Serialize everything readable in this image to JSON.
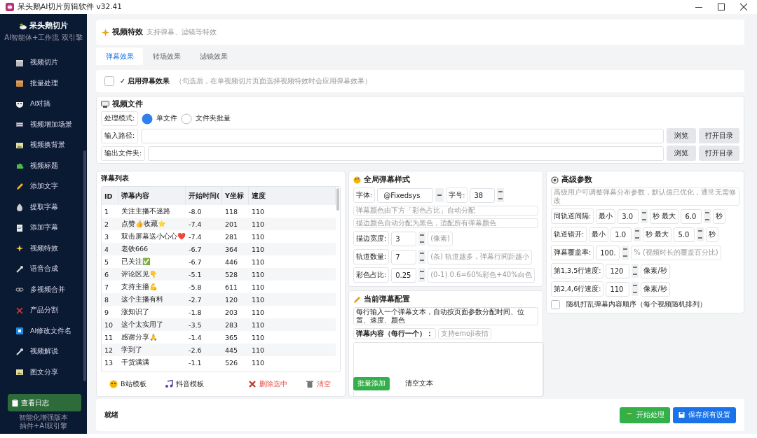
{
  "window": {
    "title": "呆头鹅AI切片剪辑软件 v32.41"
  },
  "sidebar": {
    "brand": "呆头鹅切片",
    "tagline": "AI智能体+工作流 双引擎",
    "items": [
      {
        "label": "视频切片",
        "selected": false
      },
      {
        "label": "批量处理",
        "selected": false
      },
      {
        "label": "AI对搞",
        "selected": false
      },
      {
        "label": "视频增加场景",
        "selected": false
      },
      {
        "label": "视频换背景",
        "selected": false
      },
      {
        "label": "视频标题",
        "selected": false
      },
      {
        "label": "添加文字",
        "selected": false
      },
      {
        "label": "提取字幕",
        "selected": false
      },
      {
        "label": "添加字幕",
        "selected": false
      },
      {
        "label": "视频特效",
        "selected": false
      },
      {
        "label": "语音合成",
        "selected": false
      },
      {
        "label": "多视频合并",
        "selected": false
      },
      {
        "label": "产品分割",
        "selected": false
      },
      {
        "label": "AI修改文件名",
        "selected": false
      },
      {
        "label": "视频解说",
        "selected": false
      },
      {
        "label": "图文分享",
        "selected": false
      }
    ],
    "log_button": "查看日志",
    "footer": [
      "智能化增强版本",
      "插件+AI双引擎"
    ]
  },
  "header": {
    "title": "视频特效",
    "subtitle": "支持弹幕、滤镜等特效"
  },
  "tabs": [
    {
      "label": "弹幕效果",
      "selected": true
    },
    {
      "label": "转场效果",
      "selected": false
    },
    {
      "label": "滤镜效果",
      "selected": false
    }
  ],
  "enable": {
    "label": "✓ 启用弹幕效果",
    "hint": "（勾选后，在单视频切片页面选择视频特效时会应用弹幕效果）",
    "checked": false
  },
  "video_file": {
    "title": "视频文件",
    "mode_label": "处理模式:",
    "modes": [
      {
        "label": "单文件",
        "selected": true
      },
      {
        "label": "文件夹批量",
        "selected": false
      }
    ],
    "paths": [
      {
        "label": "输入路径:",
        "buttons": [
          "浏览",
          "打开目录"
        ]
      },
      {
        "label": "输出文件夹:",
        "buttons": [
          "浏览",
          "打开目录"
        ]
      }
    ]
  },
  "danmaku_list": {
    "title": "弹幕列表",
    "columns": [
      "ID",
      "弹幕内容",
      "开始时间(",
      "Y坐标",
      "速度"
    ],
    "rows": [
      [
        "1",
        "关注主播不迷路",
        "-8.0",
        "118",
        "110"
      ],
      [
        "2",
        "点赞👍收藏⭐",
        "-7.4",
        "201",
        "110"
      ],
      [
        "3",
        "双击屏幕送小心心❤️",
        "-7.4",
        "281",
        "110"
      ],
      [
        "4",
        "老铁666",
        "-6.7",
        "364",
        "110"
      ],
      [
        "5",
        "已关注✅",
        "-6.7",
        "446",
        "110"
      ],
      [
        "6",
        "评论区见👇",
        "-5.1",
        "528",
        "110"
      ],
      [
        "7",
        "支持主播💪",
        "-5.8",
        "611",
        "110"
      ],
      [
        "8",
        "这个主播有料",
        "-2.7",
        "120",
        "110"
      ],
      [
        "9",
        "涨知识了",
        "-1.8",
        "203",
        "110"
      ],
      [
        "10",
        "这个太实用了",
        "-3.5",
        "283",
        "110"
      ],
      [
        "11",
        "感谢分享🙏",
        "-1.4",
        "365",
        "110"
      ],
      [
        "12",
        "学到了",
        "-2.6",
        "445",
        "110"
      ],
      [
        "13",
        "干货满满",
        "-1.1",
        "526",
        "110"
      ]
    ],
    "actions": [
      {
        "label": "B站模板",
        "kind": "bili"
      },
      {
        "label": "抖音模板",
        "kind": "douyin"
      },
      {
        "label": "删除选中",
        "kind": "delete"
      },
      {
        "label": "清空",
        "kind": "clear"
      }
    ]
  },
  "global_style": {
    "title": "全局弹幕样式",
    "font_label": "字体:",
    "font_value": "@Fixedsys",
    "size_label": "字号:",
    "size_value": "38",
    "notes": [
      "弹幕颜色由下方「彩色占比」自动分配",
      "描边颜色自动分配为黑色，适配所有弹幕颜色"
    ],
    "params": [
      {
        "label": "描边宽度:",
        "value": "3",
        "hint": "(像素)"
      },
      {
        "label": "轨道数量:",
        "value": "7",
        "hint": "(条) 轨道越多，弹幕行间距越小"
      },
      {
        "label": "彩色占比:",
        "value": "0.25",
        "hint": "(0-1) 0.6=60%彩色+40%白色"
      }
    ]
  },
  "advanced": {
    "title": "高级参数",
    "note": "高级用户可调整弹幕分布参数，默认值已优化，通常无需修改",
    "ranges": [
      {
        "label": "同轨道间隔:",
        "min_label": "最小",
        "min": "3.0",
        "mid_label": "秒 最大",
        "max": "6.0",
        "unit": "秒"
      },
      {
        "label": "轨道错开:",
        "min_label": "最小",
        "min": "1.0",
        "mid_label": "秒 最大",
        "max": "5.0",
        "unit": "秒"
      }
    ],
    "params": [
      {
        "label": "弹幕覆盖率:",
        "value": "100.",
        "unit": "% (视频时长的覆盖百分比)"
      },
      {
        "label": "第1,3,5行速度:",
        "value": "120",
        "unit": "像素/秒"
      },
      {
        "label": "第2,4,6行速度:",
        "value": "110",
        "unit": "像素/秒"
      }
    ],
    "shuffle": {
      "label": "随机打乱弹幕内容顺序（每个视频随机排列）",
      "checked": false
    }
  },
  "current": {
    "title": "当前弹幕配置",
    "note": "每行输入一个弹幕文本，自动按页面参数分配时间、位置、速度、颜色",
    "content_label": "弹幕内容（每行一个）：",
    "content_hint": "支持emoji表情",
    "buttons": [
      {
        "label": "批量添加",
        "kind": "primary"
      },
      {
        "label": "清空文本",
        "kind": "plain"
      }
    ]
  },
  "status": {
    "text": "就绪",
    "buttons": [
      {
        "label": "开始处理",
        "kind": "start"
      },
      {
        "label": "保存所有设置",
        "kind": "save"
      }
    ]
  }
}
